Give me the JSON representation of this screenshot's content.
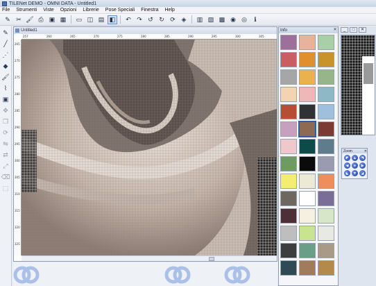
{
  "window": {
    "title": "TILENet DEMO - OMNI DATA - Untitled1"
  },
  "menu": [
    "File",
    "Strumenti",
    "Viste",
    "Opzioni",
    "Librerie",
    "Pose Speciali",
    "Finestra",
    "Help"
  ],
  "toolbar_icons": [
    "new-icon",
    "cut-icon",
    "paint-icon",
    "print-icon",
    "save-icon",
    "grid-icon",
    "rectangle-icon",
    "tile-icon",
    "wall-icon",
    "tile-select-icon",
    "undo-icon",
    "redo-icon",
    "rotate-left-icon",
    "rotate-right-icon",
    "rotate-icon",
    "paint-bucket-icon",
    "view-2d-icon",
    "view-3d-icon",
    "render-icon",
    "camera-icon",
    "globe-icon",
    "info-icon"
  ],
  "left_tools": [
    "pencil-icon",
    "line-icon",
    "multi-line-icon",
    "fill-icon",
    "paint-icon",
    "eyedropper-icon",
    "stamp-icon",
    "move-icon",
    "copy-icon",
    "rotate-icon",
    "flip-icon",
    "mirror-icon",
    "scale-icon",
    "erase-icon",
    "select-icon"
  ],
  "document": {
    "title": "Untitled1",
    "ruler_h": [
      "257",
      "260",
      "265",
      "270",
      "275",
      "280",
      "285",
      "290",
      "295",
      "300",
      "305"
    ],
    "ruler_v": [
      "265",
      "270",
      "275",
      "280",
      "285",
      "290",
      "295",
      "300",
      "305",
      "310",
      "315",
      "320",
      "325"
    ]
  },
  "info_panel": {
    "title": "Info",
    "close": "✕",
    "swatches": [
      "#9d6f9a",
      "#e8b39a",
      "#a8cfa8",
      "#c95f63",
      "#e08e2e",
      "#c9932c",
      "#a6a6a6",
      "#e9b24c",
      "#97b58a",
      "#f3d3b0",
      "#f0b7b8",
      "#8fb8c7",
      "#b64d35",
      "#2f3135",
      "#9fc0dd",
      "#c79fbf",
      "#8e6a52",
      "#7c3a35",
      "#efc8cc",
      "#0f4a4a",
      "#5f7c8c",
      "#6e9b5f",
      "#0b0b0b",
      "#9a9ab0",
      "#f4ee6e",
      "#ece9d6",
      "#f08e5b",
      "#6d675f",
      "#ffffff",
      "#7b6e96",
      "#4e2f35",
      "#f6f0e0",
      "#d7e6c8",
      "#bebebe",
      "#c9e48f",
      "#e8e9e3",
      "#3d3d3d",
      "#6a9e86",
      "#a89a87",
      "#2e4a55",
      "#a07c5c",
      "#b48a4a"
    ],
    "selected_index": 16
  },
  "mdi_buttons": [
    "_",
    "□",
    "✕"
  ],
  "zoom": {
    "title": "Zoom",
    "close": "✕",
    "buttons": [
      "◤",
      "▲",
      "◥",
      "◀",
      "●",
      "▶",
      "◣",
      "▼",
      "◢"
    ]
  }
}
